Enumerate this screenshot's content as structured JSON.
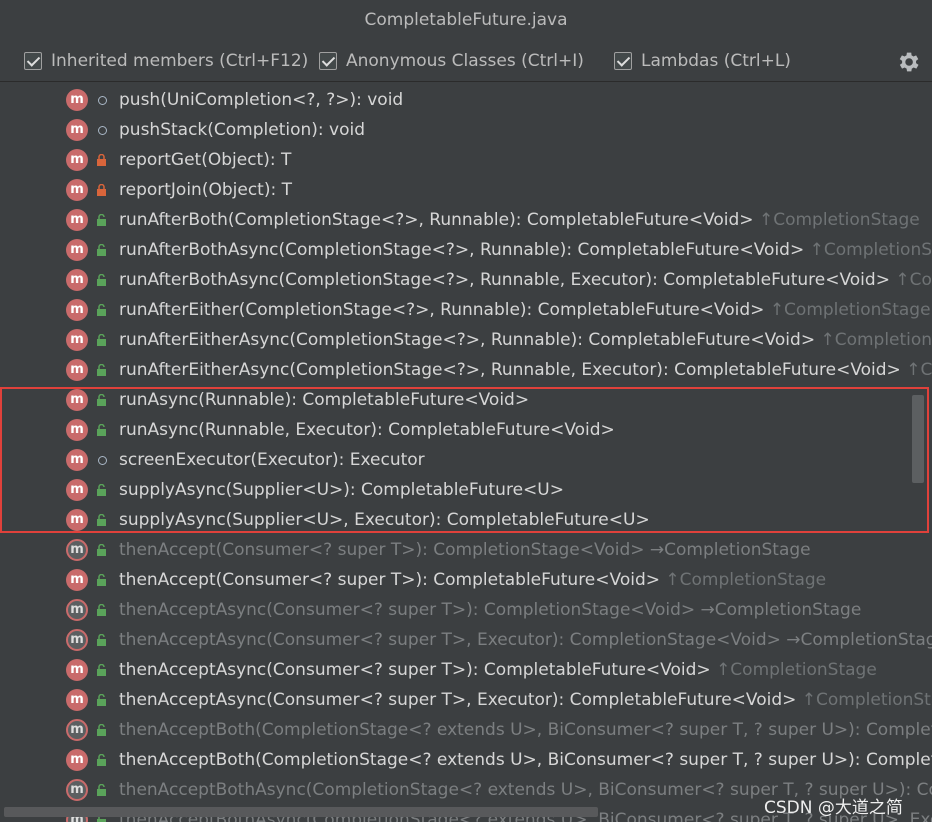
{
  "window": {
    "title": "CompletableFuture.java"
  },
  "toolbar": {
    "options": [
      {
        "label": "Inherited members (Ctrl+F12)",
        "checked": true
      },
      {
        "label": "Anonymous Classes (Ctrl+I)",
        "checked": true
      },
      {
        "label": "Lambdas (Ctrl+L)",
        "checked": true
      }
    ],
    "settings_icon": "gear-icon"
  },
  "members": [
    {
      "sig": "push(UniCompletion<?, ?>): void",
      "inherited": "",
      "access": "package",
      "dim": false
    },
    {
      "sig": "pushStack(Completion): void",
      "inherited": "",
      "access": "package",
      "dim": false
    },
    {
      "sig": "reportGet(Object): T",
      "inherited": "",
      "access": "private",
      "dim": false
    },
    {
      "sig": "reportJoin(Object): T",
      "inherited": "",
      "access": "private",
      "dim": false
    },
    {
      "sig": "runAfterBoth(CompletionStage<?>, Runnable): CompletableFuture<Void> ",
      "inherited": "↑CompletionStage",
      "access": "public",
      "dim": false
    },
    {
      "sig": "runAfterBothAsync(CompletionStage<?>, Runnable): CompletableFuture<Void> ",
      "inherited": "↑CompletionStage",
      "access": "public",
      "dim": false
    },
    {
      "sig": "runAfterBothAsync(CompletionStage<?>, Runnable, Executor): CompletableFuture<Void> ",
      "inherited": "↑Comple",
      "access": "public",
      "dim": false
    },
    {
      "sig": "runAfterEither(CompletionStage<?>, Runnable): CompletableFuture<Void> ",
      "inherited": "↑CompletionStage",
      "access": "public",
      "dim": false
    },
    {
      "sig": "runAfterEitherAsync(CompletionStage<?>, Runnable): CompletableFuture<Void> ",
      "inherited": "↑CompletionStag",
      "access": "public",
      "dim": false
    },
    {
      "sig": "runAfterEitherAsync(CompletionStage<?>, Runnable, Executor): CompletableFuture<Void> ",
      "inherited": "↑Compl",
      "access": "public",
      "dim": false
    },
    {
      "sig": "runAsync(Runnable): CompletableFuture<Void>",
      "inherited": "",
      "access": "public",
      "dim": false
    },
    {
      "sig": "runAsync(Runnable, Executor): CompletableFuture<Void>",
      "inherited": "",
      "access": "public",
      "dim": false
    },
    {
      "sig": "screenExecutor(Executor): Executor",
      "inherited": "",
      "access": "package",
      "dim": false
    },
    {
      "sig": "supplyAsync(Supplier<U>): CompletableFuture<U>",
      "inherited": "",
      "access": "public",
      "dim": false
    },
    {
      "sig": "supplyAsync(Supplier<U>, Executor): CompletableFuture<U>",
      "inherited": "",
      "access": "public",
      "dim": false
    },
    {
      "sig": "thenAccept(Consumer<? super T>): CompletionStage<Void> →CompletionStage",
      "inherited": "",
      "access": "public",
      "dim": true
    },
    {
      "sig": "thenAccept(Consumer<? super T>): CompletableFuture<Void> ",
      "inherited": "↑CompletionStage",
      "access": "public",
      "dim": false
    },
    {
      "sig": "thenAcceptAsync(Consumer<? super T>): CompletionStage<Void> →CompletionStage",
      "inherited": "",
      "access": "public",
      "dim": true
    },
    {
      "sig": "thenAcceptAsync(Consumer<? super T>, Executor): CompletionStage<Void> →CompletionStage",
      "inherited": "",
      "access": "public",
      "dim": true
    },
    {
      "sig": "thenAcceptAsync(Consumer<? super T>): CompletableFuture<Void> ",
      "inherited": "↑CompletionStage",
      "access": "public",
      "dim": false
    },
    {
      "sig": "thenAcceptAsync(Consumer<? super T>, Executor): CompletableFuture<Void> ",
      "inherited": "↑CompletionStage",
      "access": "public",
      "dim": false
    },
    {
      "sig": "thenAcceptBoth(CompletionStage<? extends U>, BiConsumer<? super T, ? super U>): CompletionS",
      "inherited": "",
      "access": "public",
      "dim": true
    },
    {
      "sig": "thenAcceptBoth(CompletionStage<? extends U>, BiConsumer<? super T, ? super U>): Completable",
      "inherited": "",
      "access": "public",
      "dim": false
    },
    {
      "sig": "thenAcceptBothAsync(CompletionStage<? extends U>, BiConsumer<? super T, ? super U>): Compl",
      "inherited": "",
      "access": "public",
      "dim": true
    },
    {
      "sig": "thenAcceptBothAsync(CompletionStage<? extends U>, BiConsumer<? super T, ? super U>, Executo",
      "inherited": "",
      "access": "public",
      "dim": true
    }
  ],
  "watermark": "CSDN @大道之简",
  "colors": {
    "background": "#3c3f41",
    "method_icon": "#c96b6b",
    "highlight_border": "#e0413b",
    "lock_private": "#d9653b",
    "lock_public": "#5aa35a"
  }
}
